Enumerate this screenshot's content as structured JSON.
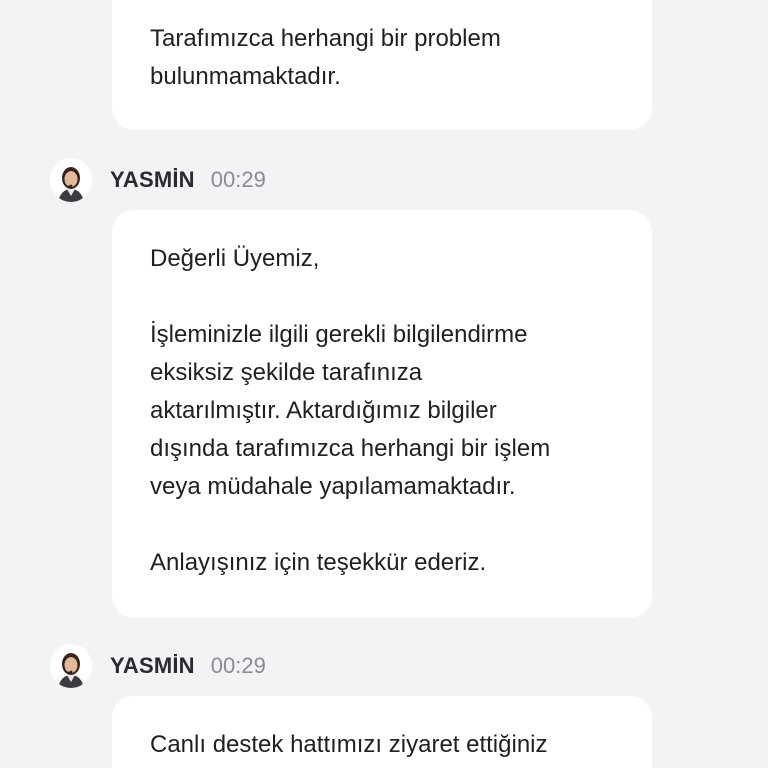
{
  "messages": [
    {
      "text": "Tarafımızca herhangi bir problem\nbulunmamaktadır."
    },
    {
      "sender": "YASMİN",
      "time": "00:29",
      "text": "Değerli Üyemiz,\n\nİşleminizle ilgili gerekli bilgilendirme\neksiksiz şekilde tarafınıza\naktarılmıştır. Aktardığımız bilgiler\ndışında tarafımızca herhangi bir işlem\nveya müdahale yapılamamaktadır.\n\nAnlayışınız için teşekkür ederiz."
    },
    {
      "sender": "YASMİN",
      "time": "00:29",
      "text": "Canlı destek hattımızı ziyaret ettiğiniz"
    }
  ],
  "colors": {
    "background": "#f3f3f6",
    "bubble": "#ffffff",
    "text": "#1f1f24",
    "time": "#8a8a92"
  },
  "icons": {
    "avatar": "support-agent-avatar-icon"
  }
}
